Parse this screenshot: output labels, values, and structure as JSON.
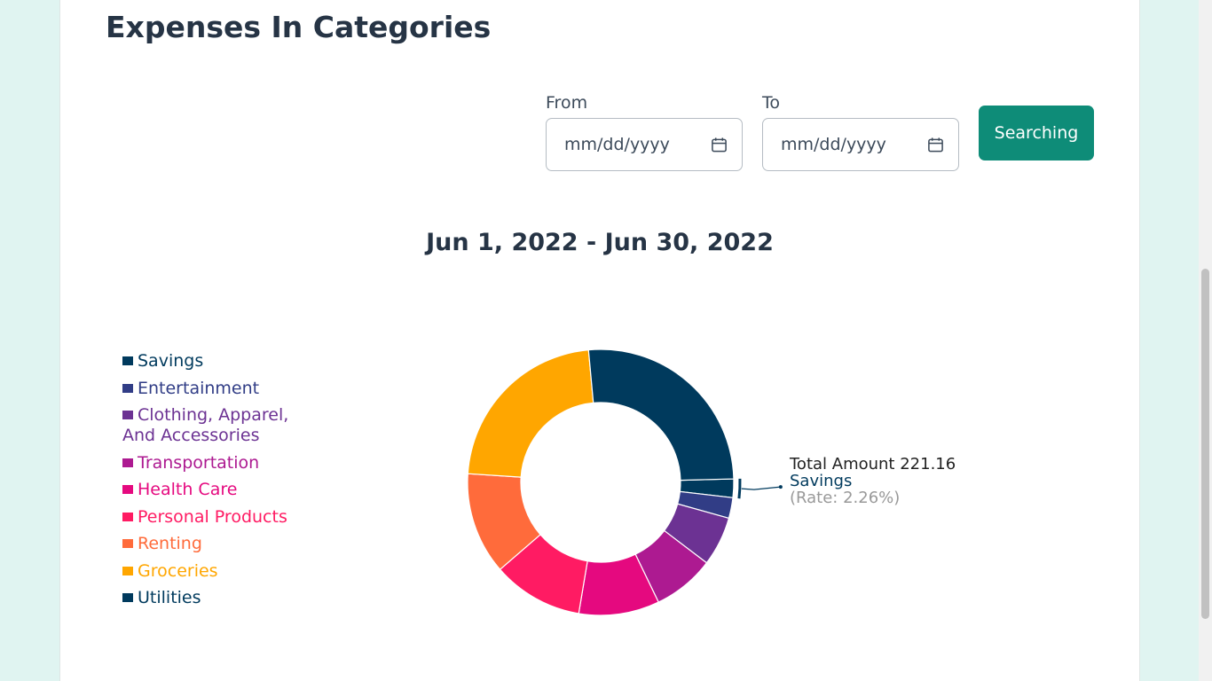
{
  "page": {
    "title": "Expenses In Categories"
  },
  "filters": {
    "from_label": "From",
    "to_label": "To",
    "from_placeholder": "mm/dd/yyyy",
    "to_placeholder": "mm/dd/yyyy",
    "search_label": "Searching"
  },
  "colors": {
    "accent": "#0e8c78",
    "title": "#263445"
  },
  "chart_data": {
    "type": "pie",
    "donut": true,
    "title": "Jun 1, 2022 - Jun 30, 2022",
    "legend_position": "left",
    "categories": [
      "Savings",
      "Entertainment",
      "Clothing, Apparel, And Accessories",
      "Transportation",
      "Health Care",
      "Personal Products",
      "Renting",
      "Groceries",
      "Utilities"
    ],
    "values": [
      2.26,
      2.5,
      6.0,
      7.5,
      9.8,
      11.0,
      12.4,
      22.5,
      26.04
    ],
    "unit": "percent (estimated from slice angles)",
    "colors": [
      "#003a5d",
      "#313d86",
      "#6c3293",
      "#ad1a91",
      "#e5097f",
      "#ff1b63",
      "#ff6b3b",
      "#ffa600",
      "#003a5d"
    ],
    "tooltip": {
      "amount_text": "Total Amount 221.16",
      "category": "Savings",
      "rate_text": "(Rate: 2.26%)"
    }
  }
}
